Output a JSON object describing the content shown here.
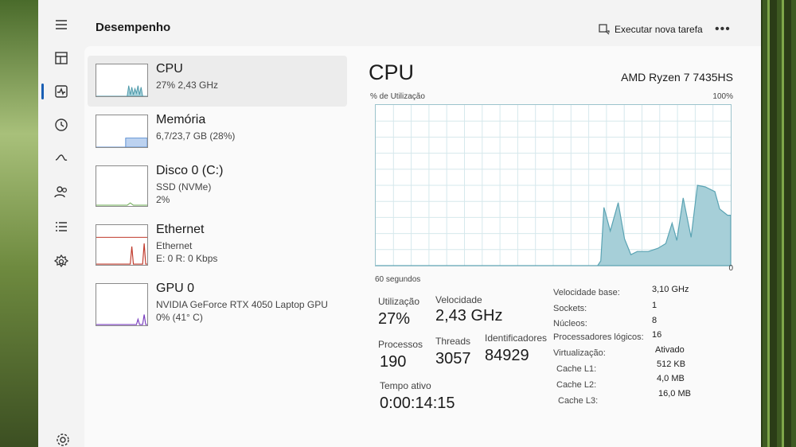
{
  "app": {
    "title": "Desempenho"
  },
  "toolbar": {
    "run_task_label": "Executar nova tarefa",
    "more_label": "•••"
  },
  "nav": {
    "items": [
      {
        "icon": "hamburger-menu-icon"
      },
      {
        "icon": "processes-icon"
      },
      {
        "icon": "performance-icon"
      },
      {
        "icon": "app-history-icon"
      },
      {
        "icon": "startup-apps-icon"
      },
      {
        "icon": "users-icon"
      },
      {
        "icon": "details-icon"
      },
      {
        "icon": "services-icon"
      },
      {
        "icon": "settings-icon"
      }
    ]
  },
  "list": {
    "cpu": {
      "title": "CPU",
      "sub1": "27% 2,43 GHz"
    },
    "memory": {
      "title": "Memória",
      "sub1": "6,7/23,7 GB (28%)"
    },
    "disk": {
      "title": "Disco 0 (C:)",
      "sub1": "SSD (NVMe)",
      "sub2": "2%"
    },
    "ethernet": {
      "title": "Ethernet",
      "sub1": "Ethernet",
      "sub2": "E: 0 R: 0 Kbps"
    },
    "gpu": {
      "title": "GPU 0",
      "sub1": "NVIDIA GeForce RTX 4050 Laptop GPU",
      "sub2": "0% (41° C)"
    }
  },
  "detail": {
    "title": "CPU",
    "model": "AMD Ryzen 7 7435HS",
    "graph_label": "% de Utilização",
    "graph_max": "100%",
    "graph_time": "60 segundos",
    "graph_zero": "0",
    "stats": {
      "utilization_label": "Utilização",
      "utilization_value": "27%",
      "speed_label": "Velocidade",
      "speed_value": "2,43 GHz",
      "processes_label": "Processos",
      "processes_value": "190",
      "threads_label": "Threads",
      "threads_value": "3057",
      "handles_label": "Identificadores",
      "handles_value": "84929",
      "uptime_label": "Tempo ativo",
      "uptime_value": "0:00:14:15"
    },
    "specs": [
      {
        "label": "Velocidade base:",
        "value": "3,10 GHz"
      },
      {
        "label": "Sockets:",
        "value": "1"
      },
      {
        "label": "Núcleos:",
        "value": "8"
      },
      {
        "label": "Processadores lógicos:",
        "value": "16"
      },
      {
        "label": "Virtualização:",
        "value": "Ativado"
      },
      {
        "label": "Cache L1:",
        "value": "512 KB"
      },
      {
        "label": "Cache L2:",
        "value": "4,0 MB"
      },
      {
        "label": "Cache L3:",
        "value": "16,0 MB"
      }
    ]
  },
  "colors": {
    "accent": "#1a5fb4",
    "cpu_graph": "#76b6c4",
    "memory_graph": "#5a8ed1",
    "ethernet_graph": "#c0392b",
    "gpu_graph": "#7a3fbf",
    "disk_graph": "#6aa84f"
  }
}
